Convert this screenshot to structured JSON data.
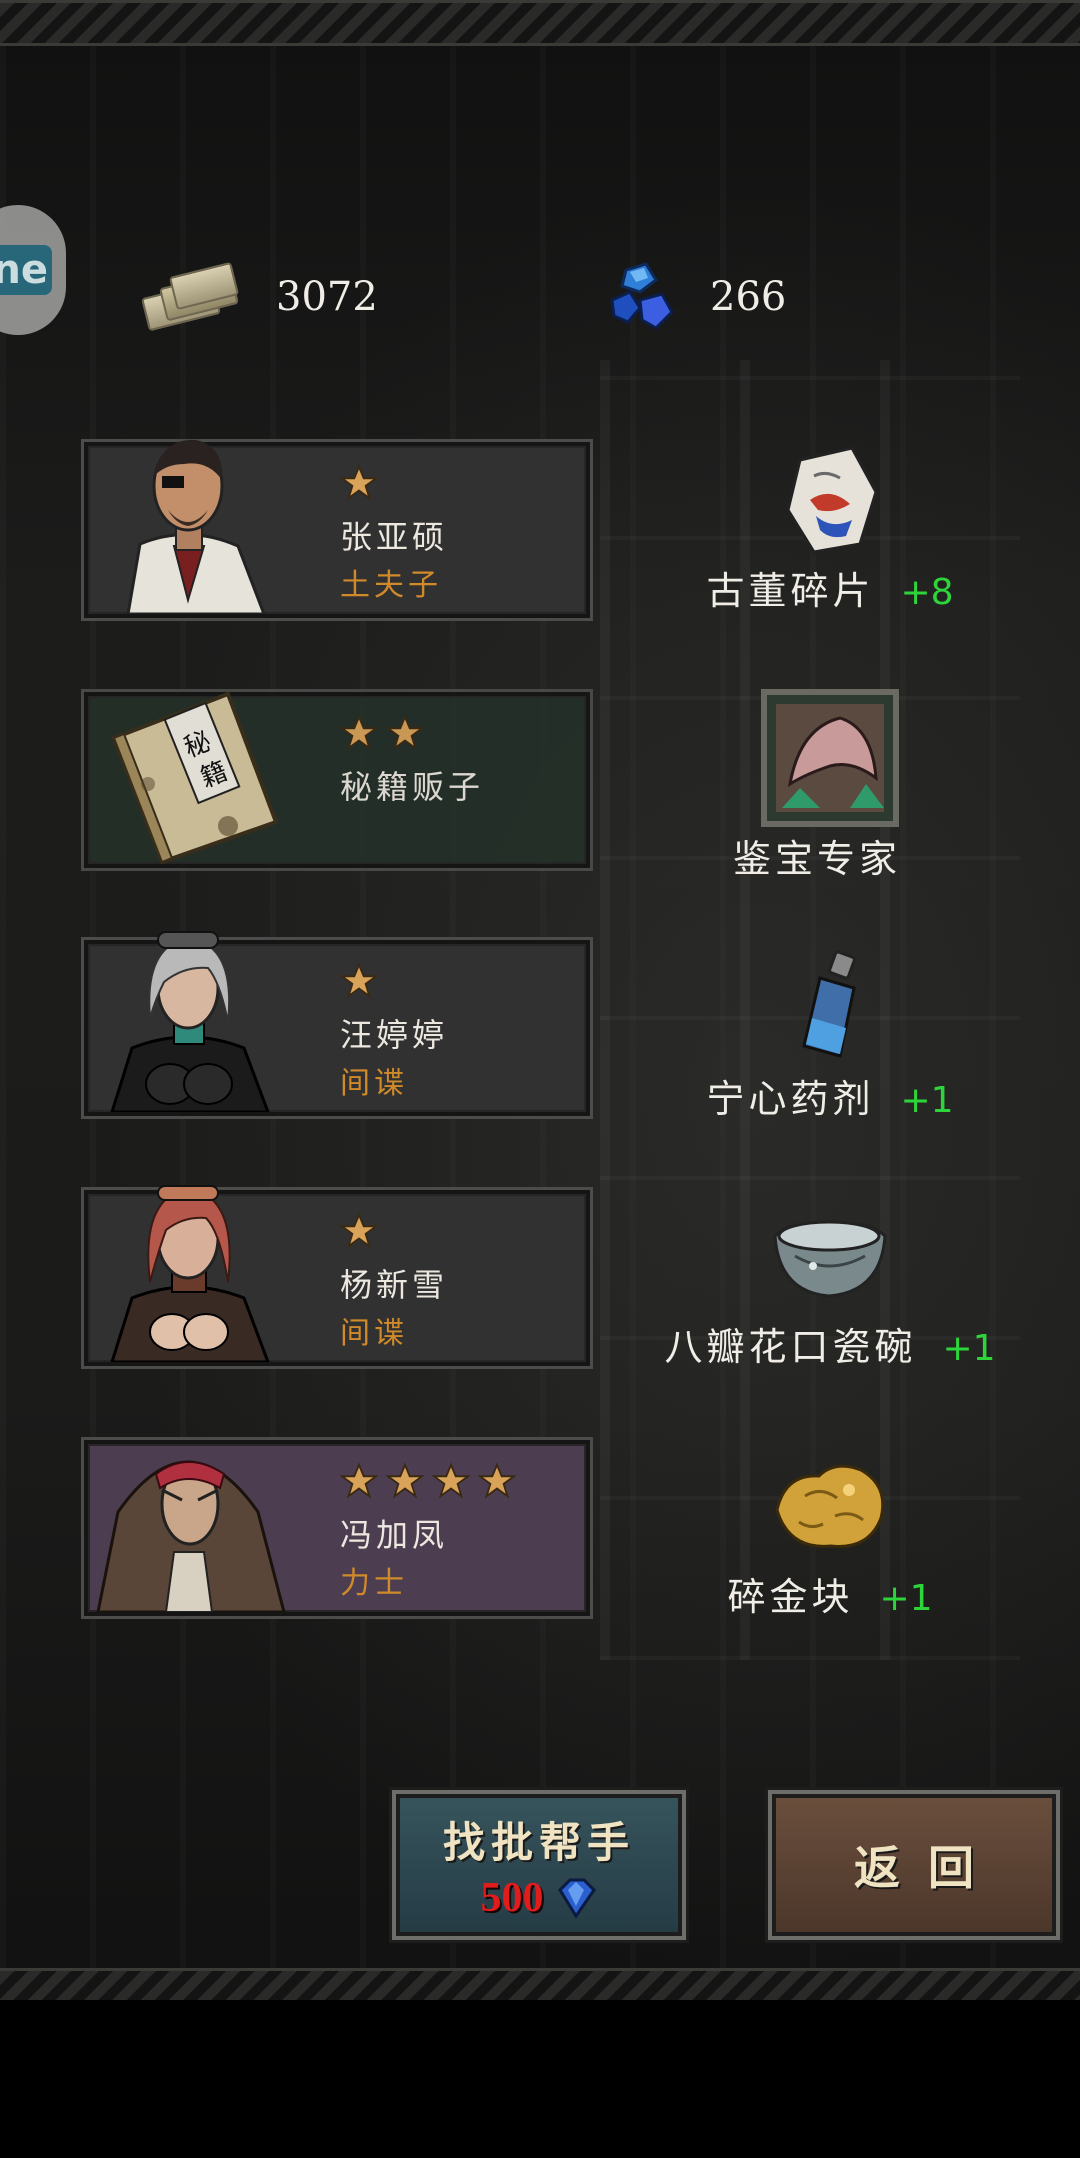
{
  "currency": {
    "cash": "3072",
    "gems": "266"
  },
  "side_button": {
    "logo_text": "ne"
  },
  "roster": [
    {
      "name": "张亚硕",
      "title": "土夫子",
      "stars": 1
    },
    {
      "name": "秘籍贩子",
      "title": "",
      "stars": 2
    },
    {
      "name": "汪婷婷",
      "title": "间谍",
      "stars": 1
    },
    {
      "name": "杨新雪",
      "title": "间谍",
      "stars": 1
    },
    {
      "name": "冯加凤",
      "title": "力士",
      "stars": 4
    }
  ],
  "rewards": [
    {
      "label": "古董碎片",
      "amount": "+8",
      "icon": "antique-fragment-icon"
    },
    {
      "label": "鉴宝专家",
      "amount": "",
      "icon": "appraisal-expert-card-icon"
    },
    {
      "label": "宁心药剂",
      "amount": "+1",
      "icon": "potion-bottle-icon"
    },
    {
      "label": "八瓣花口瓷碗",
      "amount": "+1",
      "icon": "porcelain-bowl-icon"
    },
    {
      "label": "碎金块",
      "amount": "+1",
      "icon": "gold-nugget-icon"
    }
  ],
  "buttons": {
    "help_label": "找批帮手",
    "help_cost": "500",
    "back_label": "返回"
  },
  "colors": {
    "title_orange": "#d08a2a",
    "amount_green": "#2ed53a",
    "cost_red": "#e01c1c",
    "card_purple": "#4c3d50"
  }
}
